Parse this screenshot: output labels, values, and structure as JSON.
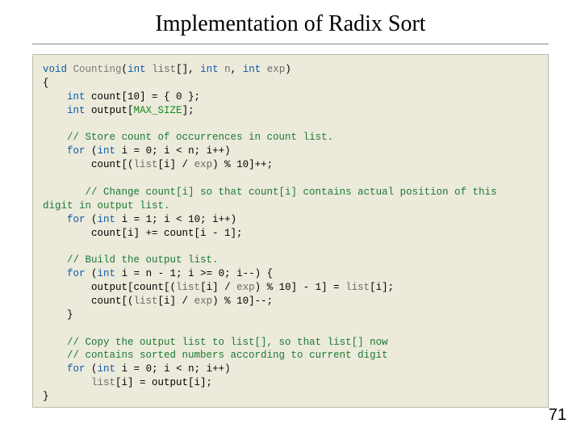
{
  "title": "Implementation of Radix Sort",
  "pagenum": "71",
  "code": {
    "sig_void": "void",
    "sig_fn": "Counting",
    "sig_p1t": "int",
    "sig_p1n": "list",
    "sig_p1br": "[], ",
    "sig_p2t": "int",
    "sig_p2n": "n",
    "sig_p2c": ", ",
    "sig_p3t": "int",
    "sig_p3n": "exp",
    "sig_close": ")",
    "lbrace": "{",
    "decl1a": "    int",
    "decl1b": " count[10] = { 0 };",
    "decl2a": "    int",
    "decl2b": " output[",
    "decl2c": "MAX_SIZE",
    "decl2d": "];",
    "c1": "    // Store count of occurrences in count list.",
    "f1a": "    for",
    "f1b": " (",
    "f1c": "int",
    "f1d": " i = 0; i < n; i++)",
    "b1a": "        count[(",
    "b1b": "list",
    "b1c": "[i] / ",
    "b1d": "exp",
    "b1e": ") % 10]++;",
    "c2a": "       // Change count[i] so that count[i] contains actual position of this",
    "c2b": "digit in output list.",
    "f2a": "    for",
    "f2b": " (",
    "f2c": "int",
    "f2d": " i = 1; i < 10; i++)",
    "b2": "        count[i] += count[i - 1];",
    "c3": "    // Build the output list.",
    "f3a": "    for",
    "f3b": " (",
    "f3c": "int",
    "f3d": " i = n - 1; i >= 0; i--) {",
    "b3a": "        output[count[(",
    "b3b": "list",
    "b3c": "[i] / ",
    "b3d": "exp",
    "b3e": ") % 10] - 1] = ",
    "b3f": "list",
    "b3g": "[i];",
    "b4a": "        count[(",
    "b4b": "list",
    "b4c": "[i] / ",
    "b4d": "exp",
    "b4e": ") % 10]--;",
    "b5": "    }",
    "c4a": "    // Copy the output list to list[], so that list[] now",
    "c4b": "    // contains sorted numbers according to current digit",
    "f4a": "    for",
    "f4b": " (",
    "f4c": "int",
    "f4d": " i = 0; i < n; i++)",
    "b6a": "        list",
    "b6b": "[i] = output[i];",
    "rbrace": "}"
  }
}
